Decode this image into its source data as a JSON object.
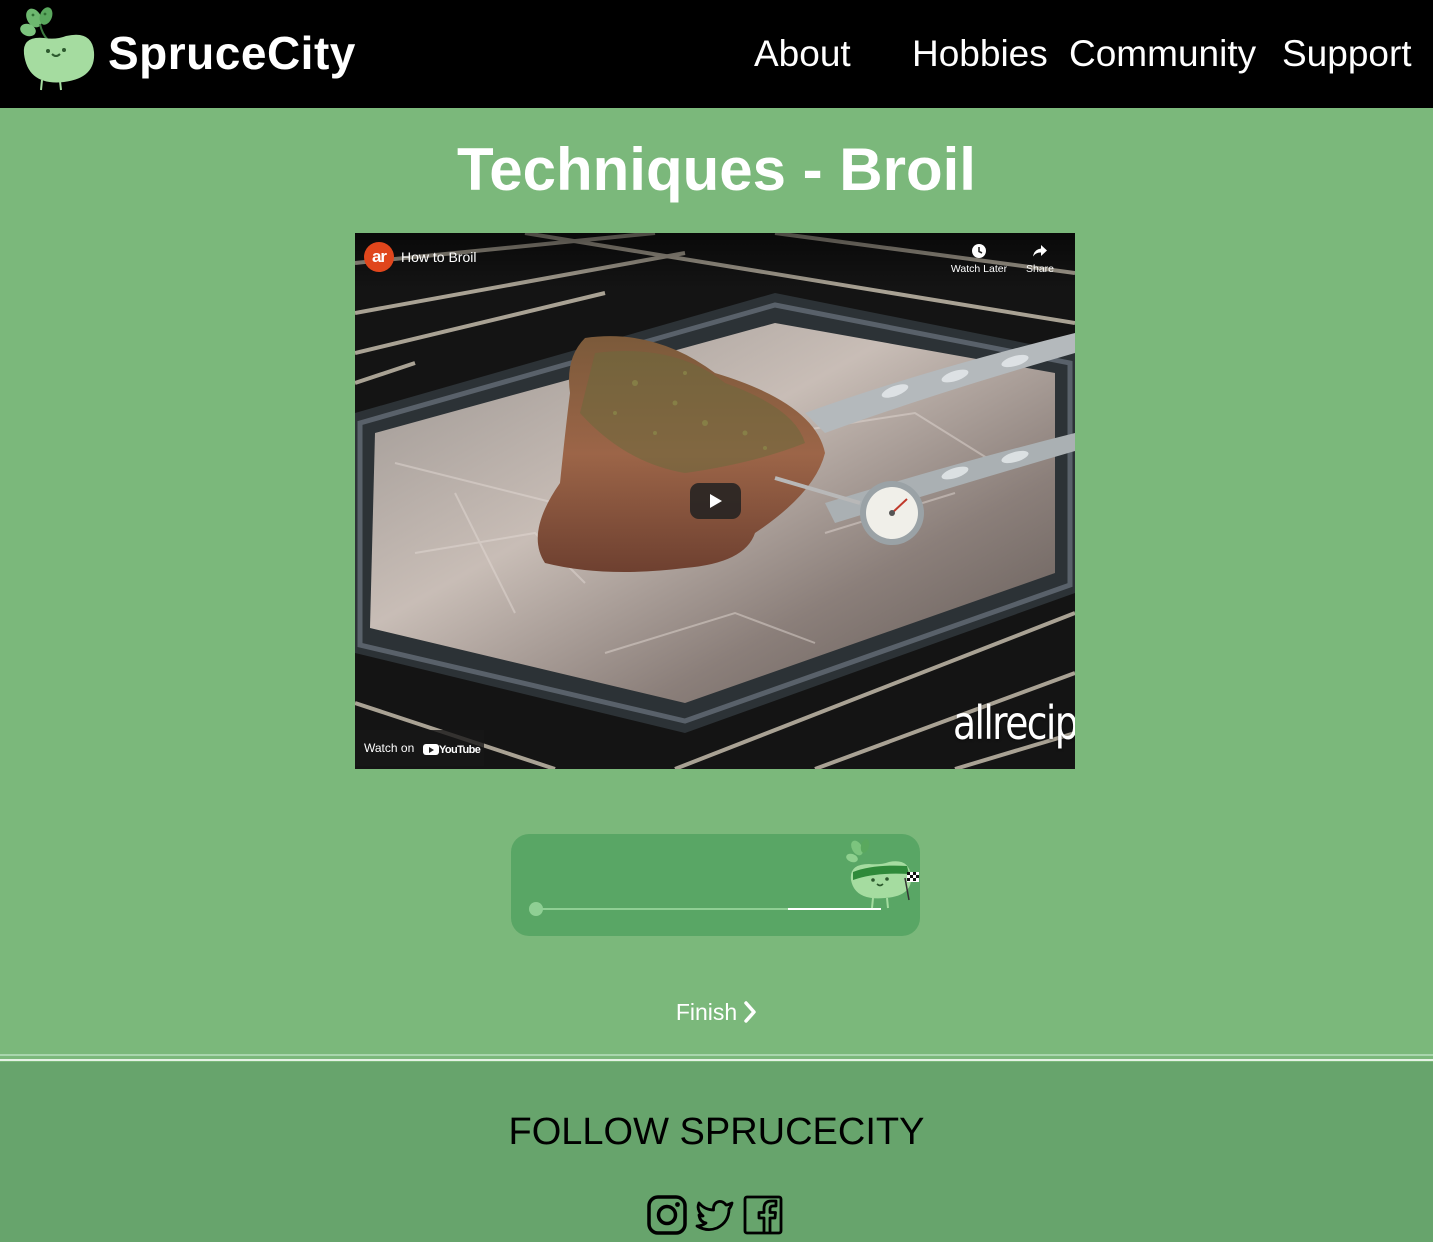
{
  "header": {
    "brand": "SpruceCity",
    "nav": [
      "About",
      "Hobbies",
      "Community",
      "Support"
    ]
  },
  "main": {
    "title": "Techniques - Broil",
    "video": {
      "channel_badge": "ar",
      "title": "How to Broil",
      "watch_later_label": "Watch Later",
      "share_label": "Share",
      "watch_on_label": "Watch on",
      "youtube_label": "YouTube",
      "watermark": "allrecipes"
    },
    "progress": {
      "fraction": 0.73
    },
    "finish_label": "Finish"
  },
  "footer": {
    "heading": "FOLLOW SPRUCECITY",
    "social_icons": [
      "instagram-icon",
      "twitter-icon",
      "facebook-icon"
    ]
  },
  "colors": {
    "page_bg": "#7bb87b",
    "header_bg": "#000000",
    "progress_card": "#59a665",
    "footer_bg": "#67a46c"
  }
}
